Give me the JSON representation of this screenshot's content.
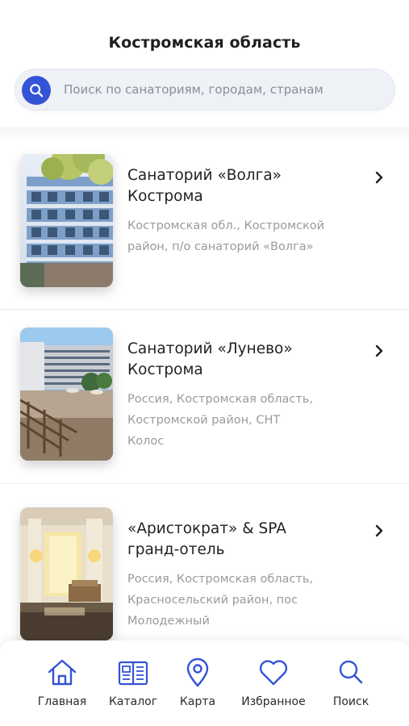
{
  "header": {
    "title": "Костромская область",
    "search_placeholder": "Поиск по санаториям, городам, странам"
  },
  "cards": [
    {
      "name_line1": "Санаторий «Волга»",
      "name_line2": "Кострома",
      "addr_line1": "Костромская обл., Костромской",
      "addr_line2": "район, п/о санаторий «Волга»",
      "addr_line3": ""
    },
    {
      "name_line1": "Санаторий «Лунево»",
      "name_line2": "Кострома",
      "addr_line1": "Россия, Костромская область,",
      "addr_line2": "Костромской район, СНТ",
      "addr_line3": "Колос"
    },
    {
      "name_line1": "«Аристократ» & SPA",
      "name_line2": "гранд-отель",
      "addr_line1": "Россия, Костромская область,",
      "addr_line2": "Красносельский район, пос",
      "addr_line3": "Молодежный"
    }
  ],
  "tabbar": {
    "items": [
      {
        "label": "Главная",
        "icon": "home-icon"
      },
      {
        "label": "Каталог",
        "icon": "catalog-icon"
      },
      {
        "label": "Карта",
        "icon": "map-pin-icon"
      },
      {
        "label": "Избранное",
        "icon": "heart-icon"
      },
      {
        "label": "Поиск",
        "icon": "search-icon"
      }
    ]
  },
  "colors": {
    "accent": "#3553d6",
    "text_primary": "#222222",
    "text_secondary": "#9a9a9a",
    "search_bg": "#eef1f5"
  }
}
